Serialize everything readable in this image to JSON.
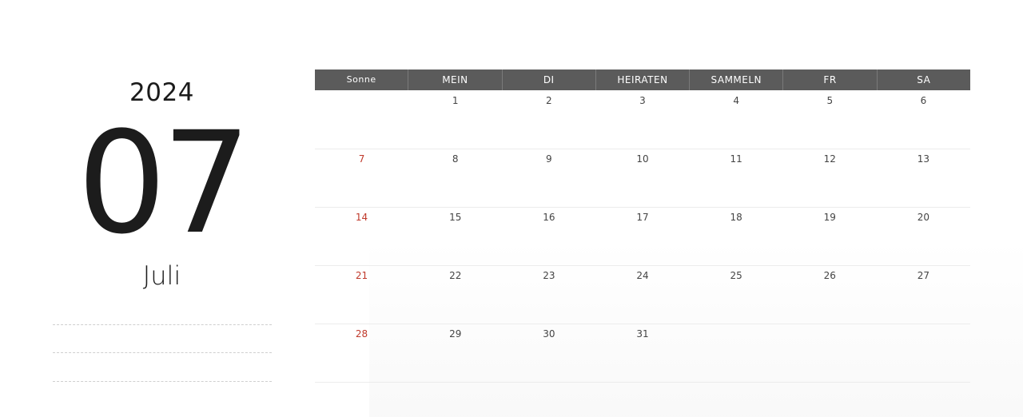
{
  "left": {
    "year": "2024",
    "month_number": "07",
    "month_name": "Juli"
  },
  "weekdays": [
    "Sonne",
    "MEIN",
    "DI",
    "HEIRATEN",
    "SAMMELN",
    "FR",
    "SA"
  ],
  "weeks": [
    [
      "",
      "1",
      "2",
      "3",
      "4",
      "5",
      "6"
    ],
    [
      "7",
      "8",
      "9",
      "10",
      "11",
      "12",
      "13"
    ],
    [
      "14",
      "15",
      "16",
      "17",
      "18",
      "19",
      "20"
    ],
    [
      "21",
      "22",
      "23",
      "24",
      "25",
      "26",
      "27"
    ],
    [
      "28",
      "29",
      "30",
      "31",
      "",
      "",
      ""
    ]
  ],
  "colors": {
    "header_bg": "#5b5b5b",
    "sunday_text": "#c0392b"
  }
}
